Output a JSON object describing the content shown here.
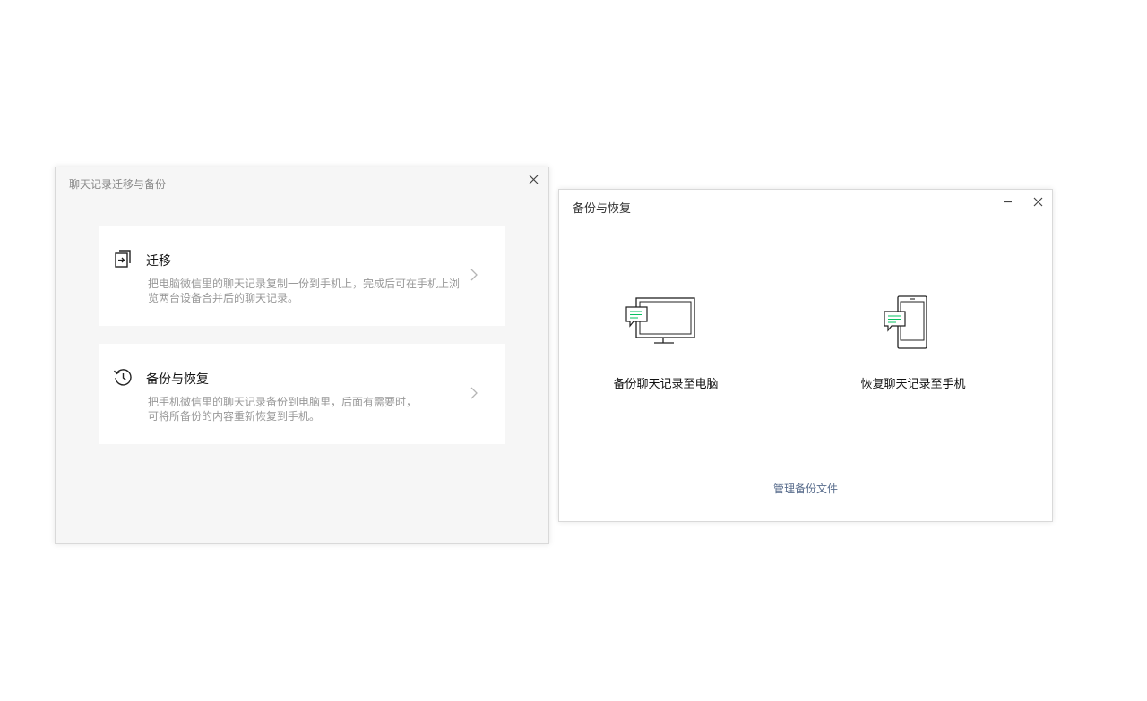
{
  "migration_dialog": {
    "title": "聊天记录迁移与备份",
    "close_icon": "close-icon",
    "options": [
      {
        "icon": "migrate-icon",
        "title": "迁移",
        "desc_line1": "把电脑微信里的聊天记录复制一份到手机上，完成后可在手机上浏",
        "desc_line2": "览两台设备合并后的聊天记录。"
      },
      {
        "icon": "history-icon",
        "title": "备份与恢复",
        "desc_line1": "把手机微信里的聊天记录备份到电脑里，后面有需要时，",
        "desc_line2": "可将所备份的内容重新恢复到手机。"
      }
    ]
  },
  "backup_dialog": {
    "title": "备份与恢复",
    "actions": [
      {
        "icon": "computer-chat-icon",
        "label": "备份聊天记录至电脑"
      },
      {
        "icon": "phone-chat-icon",
        "label": "恢复聊天记录至手机"
      }
    ],
    "manage_link": "管理备份文件"
  },
  "colors": {
    "accent_green": "#07c160",
    "link": "#586c8c",
    "panel_bg": "#f6f6f6"
  }
}
